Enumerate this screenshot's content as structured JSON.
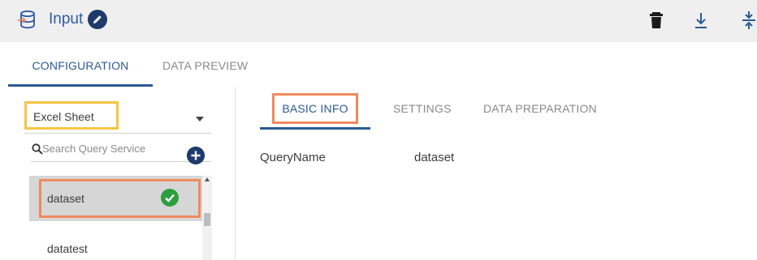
{
  "header": {
    "title": "Input",
    "icons": [
      "database-input-icon",
      "edit-icon",
      "delete-icon",
      "download-icon",
      "collapse-icon"
    ]
  },
  "top_tabs": [
    {
      "label": "CONFIGURATION",
      "active": true
    },
    {
      "label": "DATA PREVIEW",
      "active": false
    }
  ],
  "source": {
    "selected": "Excel Sheet"
  },
  "search": {
    "placeholder": "Search Query Service"
  },
  "queries": [
    {
      "label": "dataset",
      "selected": true,
      "status": "check-icon"
    },
    {
      "label": "datatest",
      "selected": false
    }
  ],
  "sub_tabs": [
    {
      "label": "BASIC INFO",
      "active": true
    },
    {
      "label": "SETTINGS",
      "active": false
    },
    {
      "label": "DATA PREPARATION",
      "active": false
    }
  ],
  "basic_info": {
    "field_label": "QueryName",
    "field_value": "dataset"
  },
  "colors": {
    "accent": "#2a5a93",
    "header_bg": "#efefef",
    "highlight_orange": "#ef8a5d",
    "highlight_yellow": "#f7c443",
    "success_green": "#2e9e3e"
  }
}
